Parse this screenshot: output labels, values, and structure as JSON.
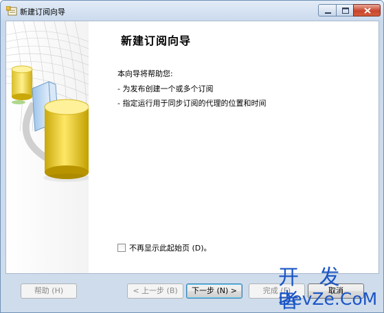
{
  "window": {
    "title": "新建订阅向导"
  },
  "page": {
    "heading": "新建订阅向导",
    "intro": "本向导将帮助您:",
    "bullets": [
      "-  为发布创建一个或多个订阅",
      "-  指定运行用于同步订阅的代理的位置和时间"
    ],
    "checkbox_label": "不再显示此起始页 (D)。",
    "checkbox_checked": false
  },
  "buttons": {
    "help": "帮助 (H)",
    "back": "< 上一步 (B)",
    "next": "下一步 (N) >",
    "finish": "完成 (F)",
    "cancel": "取消"
  },
  "watermark": {
    "top": "开 发 者",
    "bottom": "DevZe.CoM"
  },
  "colors": {
    "titlebar": "#cbdaee",
    "close_button": "#c7452c",
    "watermark": "#1b55c4"
  },
  "icons": [
    "wizard-app-icon",
    "minimize-icon",
    "maximize-icon",
    "close-icon",
    "database-illustration"
  ]
}
